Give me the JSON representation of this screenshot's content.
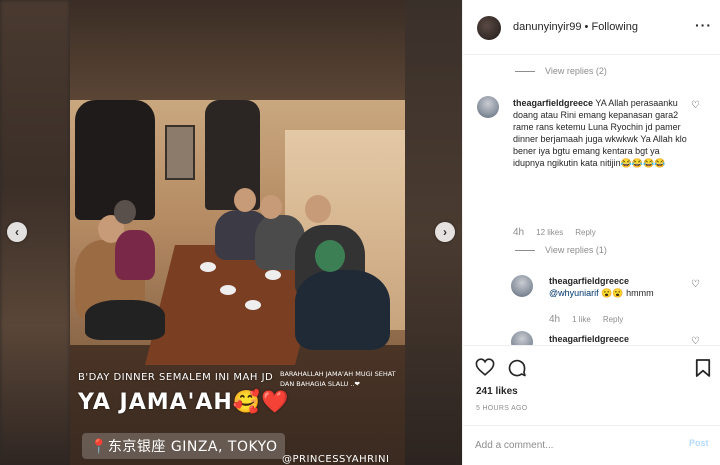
{
  "story": {
    "line1": "B'DAY DINNER SEMALEM INI MAH JD",
    "line2": "YA JAMA'AH🥰❤️",
    "side_note": "BARAHALLAH JAMA'AH MUGI SEHAT DAN BAHAGIA SLALU ..❤",
    "location": "📍东京银座 GINZA, TOKYO",
    "tag": "@PRINCESSYAHRINI"
  },
  "nav": {
    "prev": "‹",
    "next": "›"
  },
  "header": {
    "username": "danunyinyir99",
    "separator": " • ",
    "follow_status": "Following",
    "more": "···"
  },
  "comments": {
    "top_view_replies": "View replies (2)",
    "main": {
      "username": "theagarfieldgreece",
      "text": "YA Allah perasaanku doang atau Rini emang kepanasan gara2 rame rans ketemu Luna Ryochin jd pamer dinner berjamaah juga wkwkwk Ya Allah klo bener iya bgtu emang kentara bgt ya idupnya ngikutin kata nitijin😂😂😂😂",
      "time": "4h",
      "likes": "12 likes",
      "reply": "Reply",
      "view_replies": "View replies (1)"
    },
    "reply1": {
      "username": "theagarfieldgreece",
      "mention": "@whyuniarif",
      "text": " 😮😮 hmmm",
      "time": "4h",
      "likes": "1 like",
      "reply": "Reply"
    },
    "reply2": {
      "username": "theagarfieldgreece"
    }
  },
  "actions": {
    "likes": "241 likes",
    "time": "5 HOURS AGO"
  },
  "add_comment": {
    "placeholder": "Add a comment...",
    "post": "Post"
  },
  "colors": {
    "text": "#262626",
    "muted": "#8e8e8e",
    "link": "#00376b",
    "post_disabled": "#b3dbff"
  }
}
